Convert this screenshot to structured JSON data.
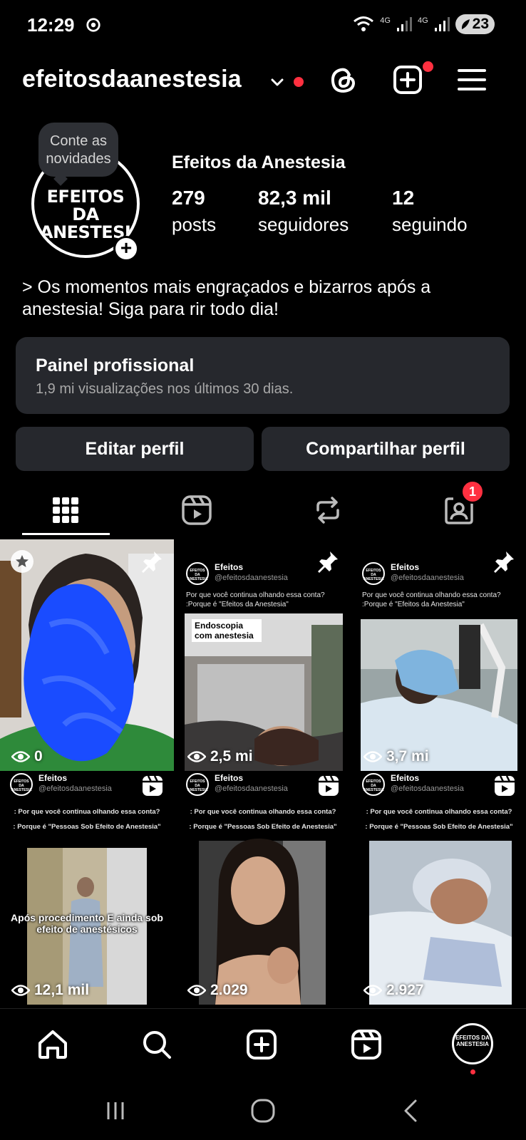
{
  "status_bar": {
    "time": "12:29",
    "net1": "4G",
    "net2": "4G",
    "battery": "23"
  },
  "header": {
    "username": "efeitosdaanestesia"
  },
  "profile": {
    "tooltip": "Conte as novidades",
    "avatar_logo": "EFEITOS DA ANESTESIA",
    "display_name": "Efeitos da Anestesia",
    "stats": [
      {
        "value": "279",
        "label": "posts"
      },
      {
        "value": "82,3 mil",
        "label": "seguidores"
      },
      {
        "value": "12",
        "label": "seguindo"
      }
    ],
    "bio": "> Os momentos mais engraçados e bizarros após a anestesia!  Siga para rir todo dia!"
  },
  "panel": {
    "title": "Painel profissional",
    "subtitle": "1,9 mi visualizações nos últimos 30 dias."
  },
  "buttons": {
    "edit": "Editar perfil",
    "share": "Compartilhar perfil"
  },
  "tabs": {
    "tagged_badge": "1"
  },
  "posts": [
    {
      "views": "0"
    },
    {
      "views": "2,5 mi",
      "name": "Efeitos",
      "handle": "@efeitosdaanestesia",
      "q1": "Por que você continua olhando essa conta?",
      "q2": ":Porque é \"Efeitos da Anestesia\"",
      "caption": "Endoscopia com anestesia"
    },
    {
      "views": "3,7 mi",
      "name": "Efeitos",
      "handle": "@efeitosdaanestesia",
      "q1": "Por que você continua olhando essa conta?",
      "q2": ":Porque é \"Efeitos da Anestesia\""
    },
    {
      "views": "12,1 mil",
      "name": "Efeitos",
      "handle": "@efeitosdaanestesia",
      "q1": ": Por que você continua olhando essa conta?",
      "q2": ": Porque é \"Pessoas Sob Efeito de Anestesia\"",
      "caption": "Após procedimento E ainda sob efeito de anestésicos"
    },
    {
      "views": "2.029",
      "name": "Efeitos",
      "handle": "@efeitosdaanestesia",
      "q1": ": Por que você continua olhando essa conta?",
      "q2": ": Porque é \"Pessoas Sob Efeito de Anestesia\""
    },
    {
      "views": "2.927",
      "name": "Efeitos",
      "handle": "@efeitosdaanestesia",
      "q1": ": Por que você continua olhando essa conta?",
      "q2": ": Porque é \"Pessoas Sob Efeito de Anestesia\""
    }
  ],
  "mini_logo": "EFEITOS DA ANESTESIA",
  "bottom_nav": {
    "items": [
      "home-icon",
      "search-icon",
      "create-icon",
      "reels-icon",
      "profile-avatar"
    ]
  },
  "colors": {
    "background": "#000000",
    "card": "#26282d",
    "accent_red": "#ff3040",
    "blur_blue": "#1a4cff"
  }
}
